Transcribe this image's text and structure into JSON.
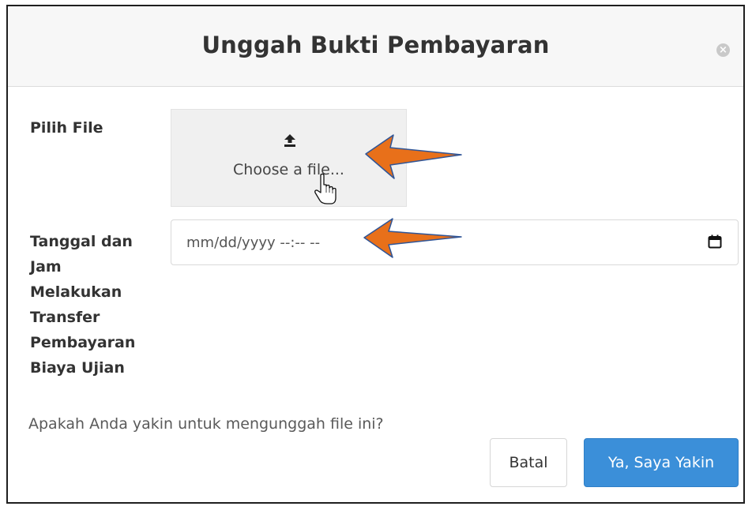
{
  "modal": {
    "title": "Unggah Bukti Pembayaran",
    "close_icon": "close-icon"
  },
  "form": {
    "file_label": "Pilih File",
    "file_button_text": "Choose a file...",
    "upload_icon": "upload-icon",
    "date_label": "Tanggal dan Jam Melakukan Transfer Pembayaran Biaya Ujian",
    "date_placeholder": "mm/dd/yyyy --:-- --",
    "calendar_icon": "calendar-icon"
  },
  "confirm": {
    "message": "Apakah Anda yakin untuk mengunggah file ini?",
    "cancel_label": "Batal",
    "confirm_label": "Ya, Saya Yakin"
  },
  "annotations": {
    "arrow_color": "#e8701a",
    "arrow_outline_color": "#2f5597",
    "cursor_icon": "hand-cursor-icon"
  }
}
